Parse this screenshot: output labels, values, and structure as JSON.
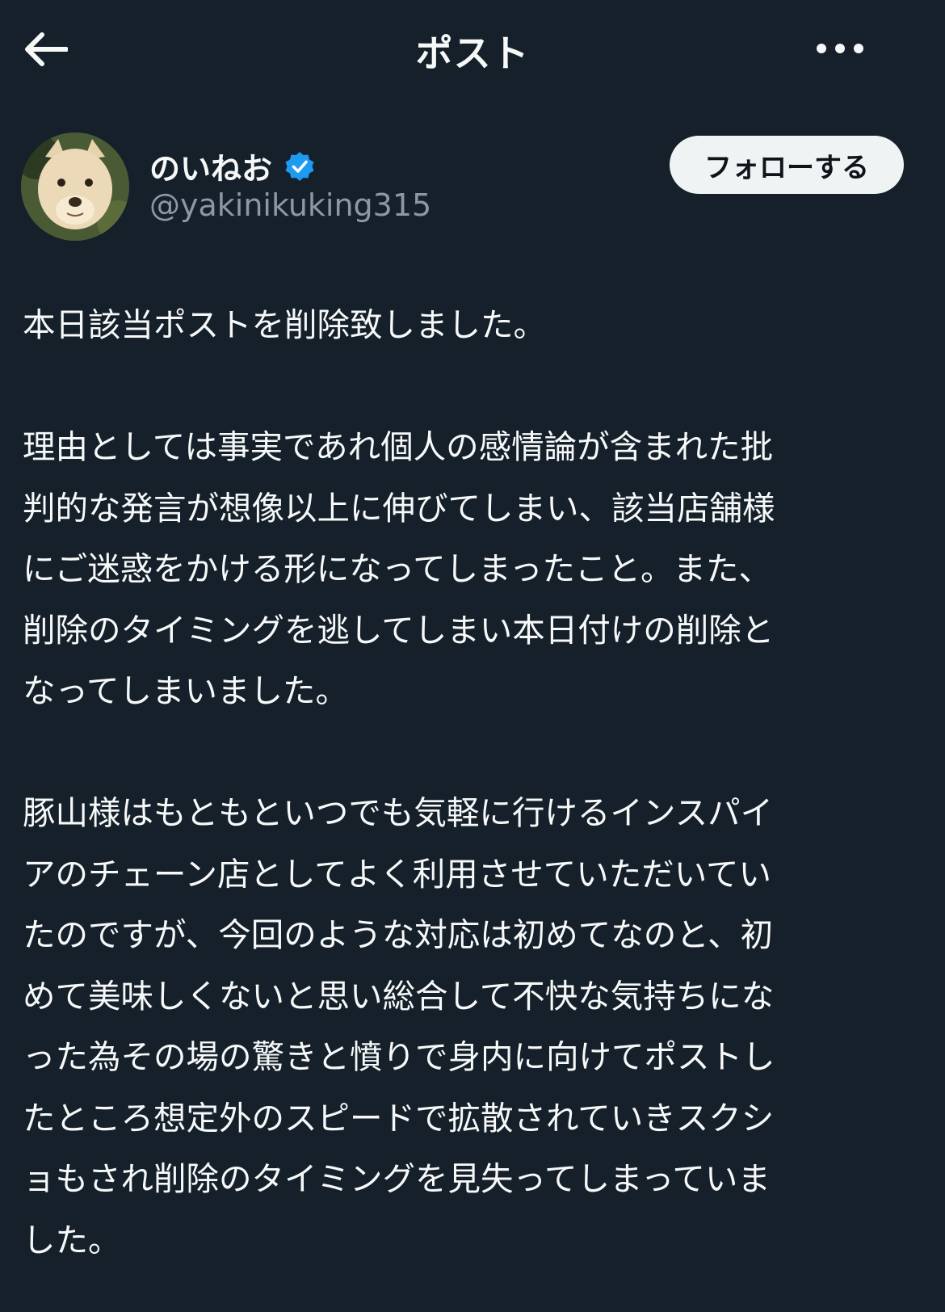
{
  "header": {
    "title": "ポスト",
    "back_icon": "arrow-left-icon",
    "more_icon": "more-horizontal-icon"
  },
  "author": {
    "display_name": "のいねお",
    "handle": "@yakinikuking315",
    "verified_icon": "verified-badge-icon",
    "follow_label": "フォローする"
  },
  "colors": {
    "background": "#15202b",
    "text": "#f7f9f9",
    "secondary_text": "#8b98a5",
    "verified": "#1d9bf0",
    "follow_bg": "#eff3f4"
  },
  "post": {
    "paragraphs": [
      {
        "lines": [
          "本日該当ポストを削除致しました。"
        ]
      },
      {
        "lines": [
          "理由としては事実であれ個人の感情論が含まれた批",
          "判的な発言が想像以上に伸びてしまい、該当店舗様",
          "にご迷惑をかける形になってしまったこと。また、",
          "削除のタイミングを逃してしまい本日付けの削除と",
          "なってしまいました。"
        ]
      },
      {
        "lines": [
          "豚山様はもともといつでも気軽に行けるインスパイ",
          "アのチェーン店としてよく利用させていただいてい",
          "たのですが、今回のような対応は初めてなのと、初",
          "めて美味しくないと思い総合して不快な気持ちにな",
          "った為その場の驚きと憤りで身内に向けてポストし",
          "たところ想定外のスピードで拡散されていきスクシ",
          "ョもされ削除のタイミングを見失ってしまっていま",
          "した。"
        ]
      }
    ]
  }
}
